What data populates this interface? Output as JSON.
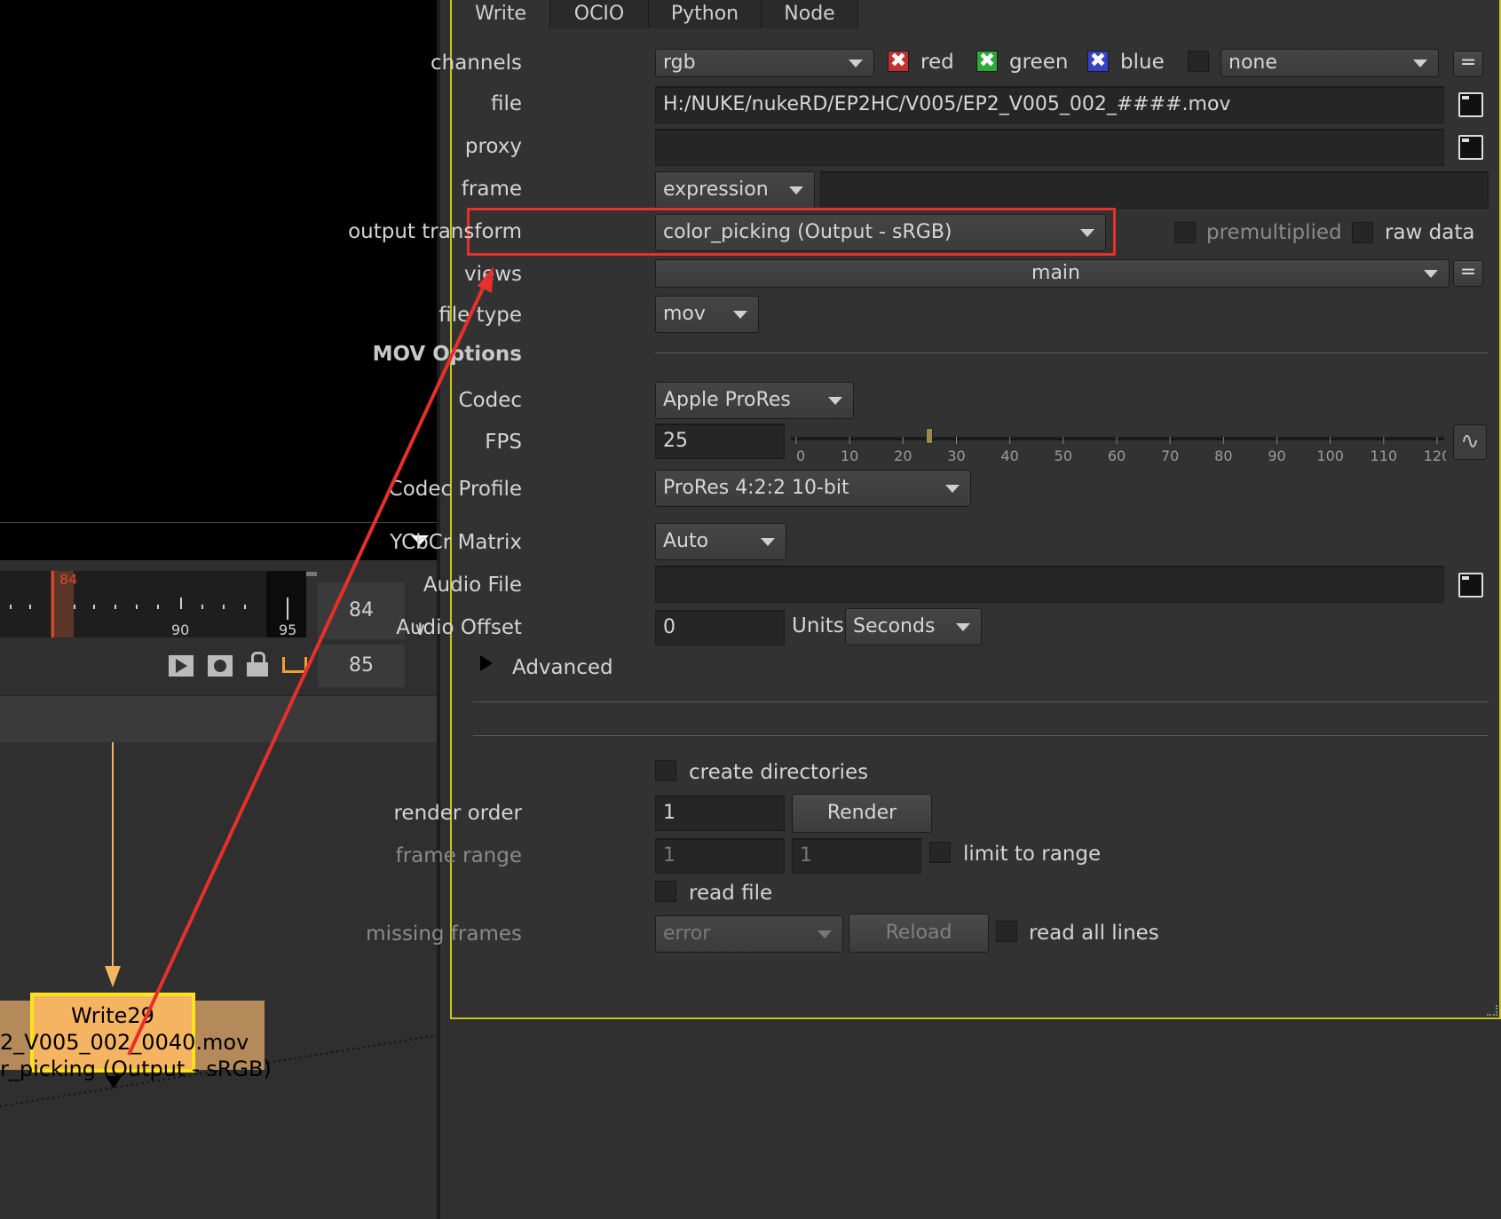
{
  "viewer": {
    "current_frame_marker": "84"
  },
  "timeline": {
    "tick_labels": [
      "90",
      "95"
    ],
    "frame_top": "84",
    "frame_bottom": "85",
    "icons": [
      "play-icon",
      "record-icon",
      "lock-icon",
      "bracket-icon"
    ]
  },
  "node": {
    "name": "Write29",
    "file_line": "2_V005_002_0040.mov",
    "transform_line": "r_picking (Output - sRGB)"
  },
  "tabs": [
    {
      "label": "Write",
      "active": true
    },
    {
      "label": "OCIO",
      "active": false
    },
    {
      "label": "Python",
      "active": false
    },
    {
      "label": "Node",
      "active": false
    }
  ],
  "form": {
    "channels_label": "channels",
    "channels_value": "rgb",
    "red": "red",
    "green": "green",
    "blue": "blue",
    "alpha_channel": "none",
    "file_label": "file",
    "file_value": "H:/NUKE/nukeRD/EP2HC/V005/EP2_V005_002_####.mov",
    "proxy_label": "proxy",
    "proxy_value": "",
    "frame_label": "frame",
    "frame_mode": "expression",
    "output_transform_label": "output transform",
    "output_transform_value": "color_picking (Output - sRGB)",
    "premultiplied": "premultiplied",
    "raw_data": "raw data",
    "views_label": "views",
    "views_value": "main",
    "file_type_label": "file type",
    "file_type_value": "mov",
    "mov_options": "MOV Options",
    "codec_label": "Codec",
    "codec_value": "Apple ProRes",
    "fps_label": "FPS",
    "fps_value": "25",
    "fps_slider_ticks": [
      "0",
      "10",
      "20",
      "30",
      "40",
      "50",
      "60",
      "70",
      "80",
      "90",
      "100",
      "110",
      "120"
    ],
    "fps_slider_fraction": 0.2083,
    "codec_profile_label": "Codec Profile",
    "codec_profile_value": "ProRes 4:2:2 10-bit",
    "ycbcr_label": "YCbCr Matrix",
    "ycbcr_value": "Auto",
    "audio_file_label": "Audio File",
    "audio_file_value": "",
    "audio_offset_label": "Audio Offset",
    "audio_offset_value": "0",
    "units_label": "Units",
    "units_value": "Seconds",
    "advanced": "Advanced",
    "create_directories": "create directories",
    "render_order_label": "render order",
    "render_order_value": "1",
    "render_button": "Render",
    "frame_range_label": "frame range",
    "frame_range_start": "1",
    "frame_range_end": "1",
    "limit_to_range": "limit to range",
    "read_file": "read file",
    "missing_frames_label": "missing frames",
    "missing_frames_value": "error",
    "reload_button": "Reload",
    "read_all_lines": "read all lines"
  },
  "colors": {
    "highlight_box": "#e8302a",
    "panel_border": "#cbc51b",
    "node_fill": "#f5b462",
    "node_outline": "#ffe21a"
  }
}
